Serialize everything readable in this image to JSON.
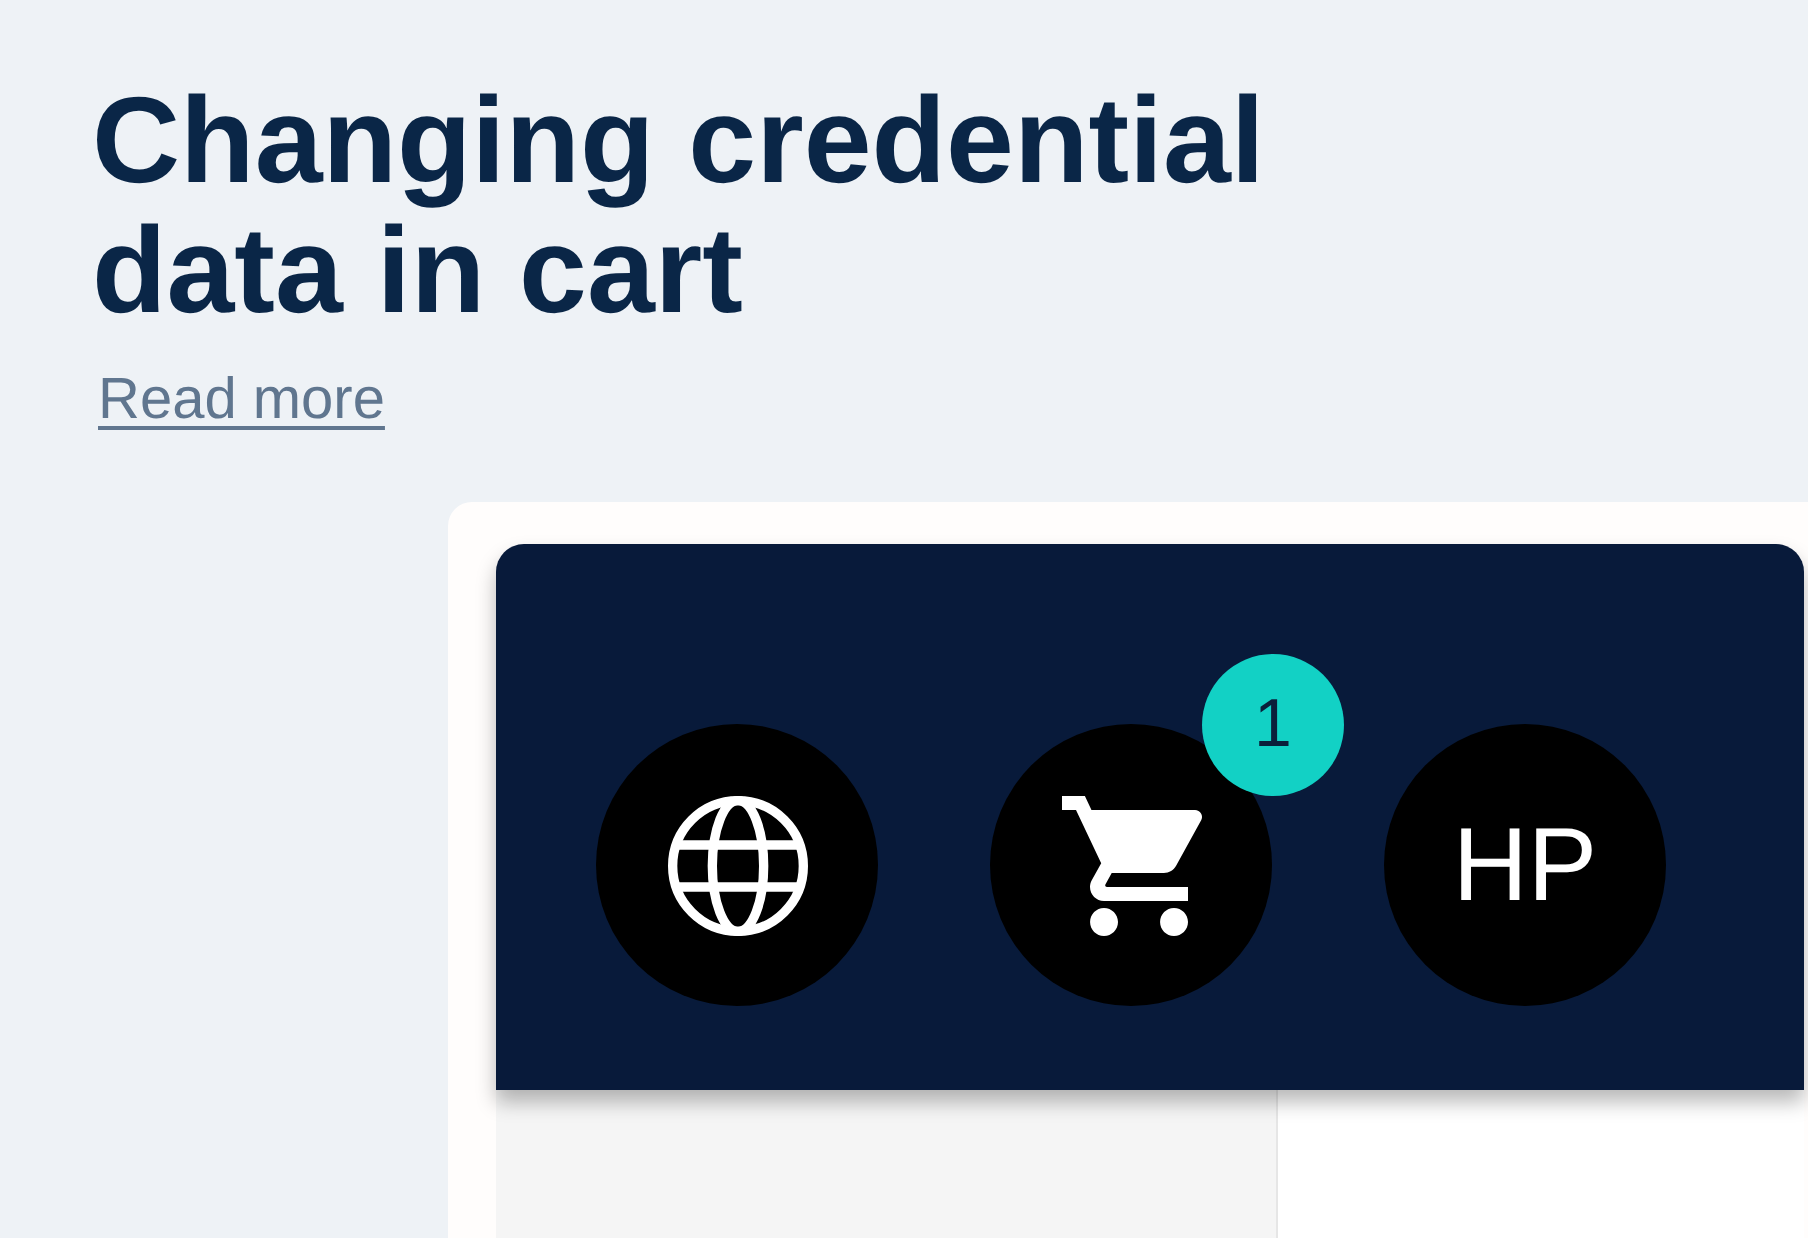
{
  "heading": {
    "title": "Changing credential data in cart",
    "link": "Read more"
  },
  "preview": {
    "header_buttons": [
      {
        "kind": "globe"
      },
      {
        "kind": "cart",
        "badge": "1"
      },
      {
        "kind": "avatar",
        "initials": "HP"
      }
    ]
  }
}
